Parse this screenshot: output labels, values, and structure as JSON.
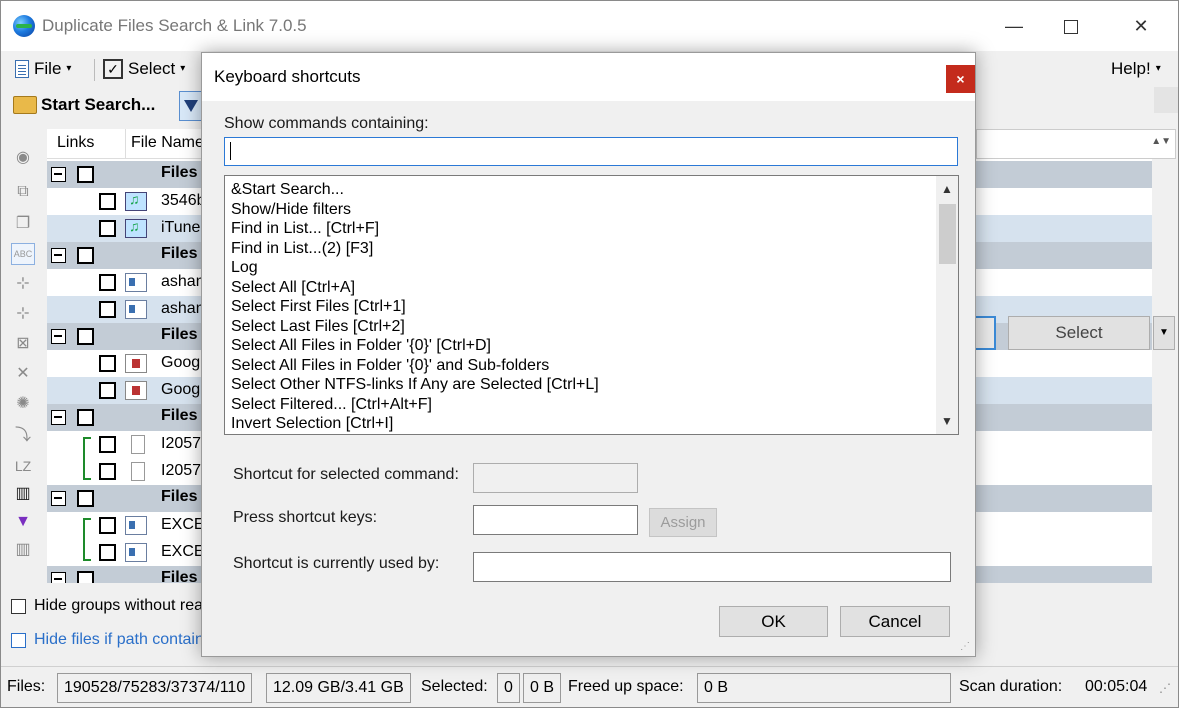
{
  "app": {
    "title": "Duplicate Files Search & Link 7.0.5",
    "win_min": "—",
    "win_close": "✕"
  },
  "menu": {
    "file": "File",
    "select": "Select",
    "help": "Help!",
    "caret": "▾"
  },
  "toolbar": {
    "start_search": "Start Search..."
  },
  "leftstrip": {
    "icons": [
      "eye-icon",
      "add-copy-icon",
      "copy-icon",
      "abc-icon",
      "tree-icon",
      "tree-icon",
      "tree-x-icon",
      "delete-x-icon",
      "gear-icon",
      "move-icon",
      "lz-icon",
      "stripe-icon",
      "funnel-icon",
      "stripe-icon"
    ],
    "abc_label": "ABC",
    "lz_label": "LZ"
  },
  "grid": {
    "columns": [
      "Links",
      "File Name"
    ],
    "rows": [
      {
        "kind": "group",
        "text": "Files"
      },
      {
        "kind": "file",
        "text": "3546b",
        "icon": "music-file-icon",
        "style": "plain"
      },
      {
        "kind": "file",
        "text": "iTune",
        "icon": "music-file-icon",
        "style": "sel"
      },
      {
        "kind": "group",
        "text": "Files"
      },
      {
        "kind": "file",
        "text": "asham",
        "icon": "document-icon",
        "style": "plain"
      },
      {
        "kind": "file",
        "text": "asham",
        "icon": "document-icon",
        "style": "sel"
      },
      {
        "kind": "group",
        "text": "Files"
      },
      {
        "kind": "file",
        "text": "Googl",
        "icon": "video-file-icon",
        "style": "plain"
      },
      {
        "kind": "file",
        "text": "Googl",
        "icon": "video-file-icon",
        "style": "sel"
      },
      {
        "kind": "group",
        "text": "Files"
      },
      {
        "kind": "file",
        "text": "I2057",
        "icon": "blank-file-icon",
        "style": "plain",
        "linked": true
      },
      {
        "kind": "file",
        "text": "I2057",
        "icon": "blank-file-icon",
        "style": "plain",
        "linked": true
      },
      {
        "kind": "group",
        "text": "Files"
      },
      {
        "kind": "file",
        "text": "EXCE",
        "icon": "document-icon",
        "style": "plain",
        "linked": true
      },
      {
        "kind": "file",
        "text": "EXCE",
        "icon": "document-icon",
        "style": "plain",
        "linked": true
      },
      {
        "kind": "group",
        "text": "Files"
      }
    ]
  },
  "right_panel": {
    "select_button": "Select",
    "dropdown_arrow": "▼",
    "scroll_arrows": "▲▼"
  },
  "options": {
    "hide_groups": "Hide groups without rea",
    "hide_files": "Hide files if path contain"
  },
  "status": {
    "files_label": "Files:",
    "files_counts": "190528/75283/37374/110",
    "sizes": "12.09 GB/3.41 GB",
    "selected_label": "Selected:",
    "selected_count": "0",
    "selected_size": "0 B",
    "freed_label": "Freed up space:",
    "freed_value": "0 B",
    "scan_label": "Scan duration:",
    "scan_value": "00:05:04"
  },
  "dialog": {
    "title": "Keyboard shortcuts",
    "close": "×",
    "filter_label": "Show commands containing:",
    "filter_value": "",
    "commands": [
      "&Start Search...",
      "Show/Hide filters",
      "Find in List... [Ctrl+F]",
      "Find in List...(2) [F3]",
      "Log",
      "Select All [Ctrl+A]",
      "Select First Files [Ctrl+1]",
      "Select Last Files [Ctrl+2]",
      "Select All Files in Folder '{0}' [Ctrl+D]",
      "Select All Files in Folder '{0}' and Sub-folders",
      "Select Other NTFS-links If Any are Selected [Ctrl+L]",
      "Select Filtered... [Ctrl+Alt+F]",
      "Invert Selection [Ctrl+I]"
    ],
    "scroll_up": "▲",
    "scroll_down": "▼",
    "shortcut_label": "Shortcut for selected command:",
    "press_label": "Press shortcut keys:",
    "assign_button": "Assign",
    "used_by_label": "Shortcut is currently used by:",
    "ok_button": "OK",
    "cancel_button": "Cancel"
  }
}
